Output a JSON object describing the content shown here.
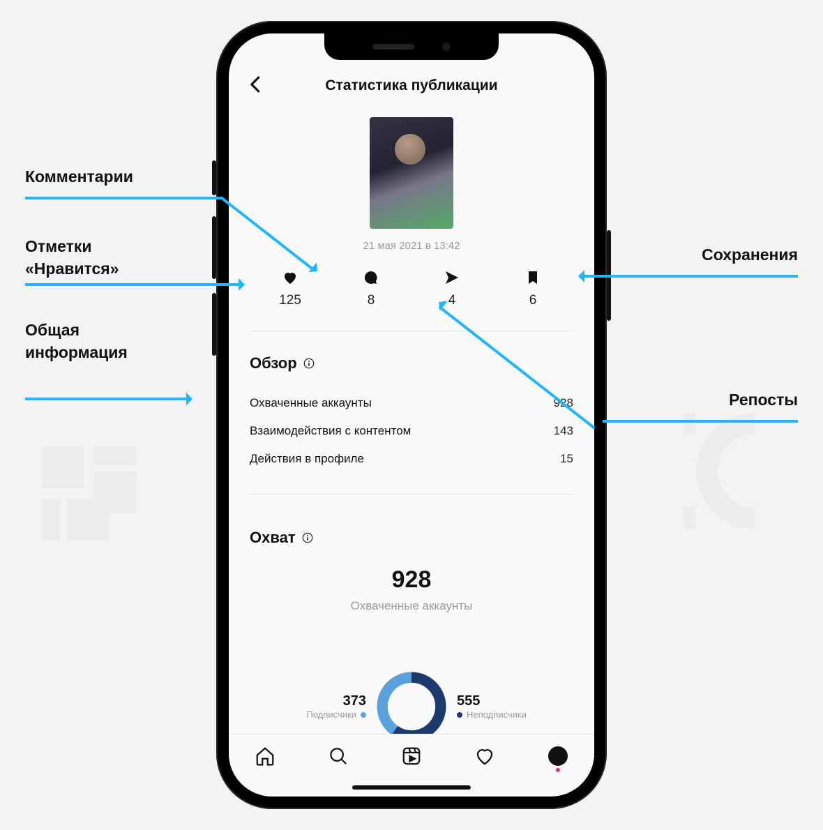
{
  "watermark": "ВИБОСС",
  "header": {
    "title": "Статистика публикации"
  },
  "post": {
    "timestamp": "21 мая 2021 в 13:42"
  },
  "stats": {
    "likes": 125,
    "comments": 8,
    "shares": 4,
    "saves": 6
  },
  "overview": {
    "title": "Обзор",
    "rows": [
      {
        "label": "Охваченные аккаунты",
        "value": 928
      },
      {
        "label": "Взаимодействия с контентом",
        "value": 143
      },
      {
        "label": "Действия в профиле",
        "value": 15
      }
    ]
  },
  "reach": {
    "title": "Охват",
    "value": 928,
    "label": "Охваченные аккаунты",
    "breakdown": {
      "followers": {
        "value": 373,
        "label": "Подписчики",
        "color": "#5aa2dd"
      },
      "nonfollowers": {
        "value": 555,
        "label": "Неподписчики",
        "color": "#1d3a6e"
      }
    }
  },
  "annotations": {
    "comments": "Комментарии",
    "likes_l1": "Отметки",
    "likes_l2": "«Нравится»",
    "general_l1": "Общая",
    "general_l2": "информация",
    "saves": "Сохранения",
    "reposts": "Репосты"
  },
  "colors": {
    "accent": "#1fb6ff"
  },
  "chart_data": {
    "type": "pie",
    "title": "Охват",
    "series": [
      {
        "name": "Подписчики",
        "value": 373,
        "color": "#5aa2dd"
      },
      {
        "name": "Неподписчики",
        "value": 555,
        "color": "#1d3a6e"
      }
    ],
    "total": 928
  }
}
